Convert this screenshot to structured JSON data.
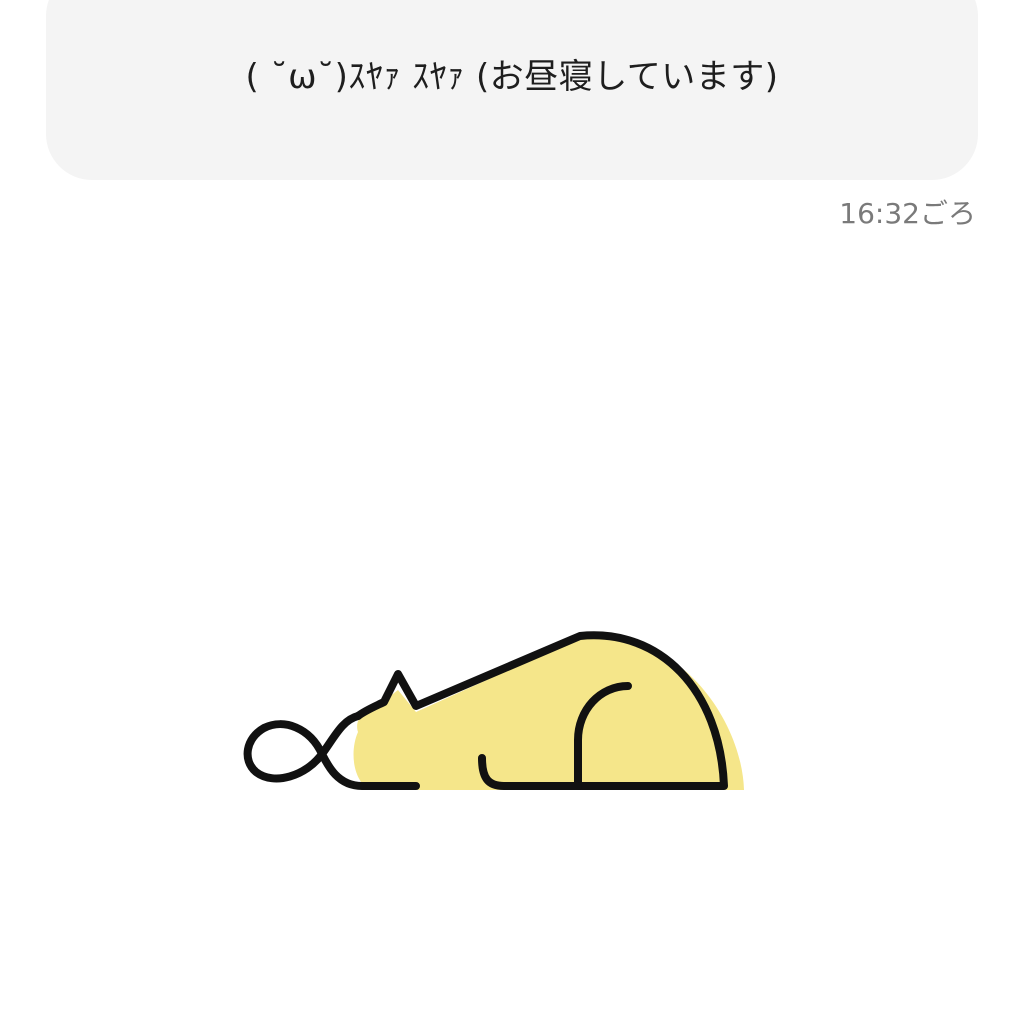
{
  "message": {
    "text": "( ˘ω˘)ｽﾔｧ ｽﾔｧ  (お昼寝しています)",
    "timestamp": "16:32ごろ"
  },
  "illustration": {
    "icon": "sleeping-cat-icon",
    "fill_color": "#f5e68a",
    "stroke_color": "#111111"
  },
  "colors": {
    "background": "#ffffff",
    "bubble_background": "#f4f4f4",
    "timestamp_color": "#7a7a7a"
  }
}
